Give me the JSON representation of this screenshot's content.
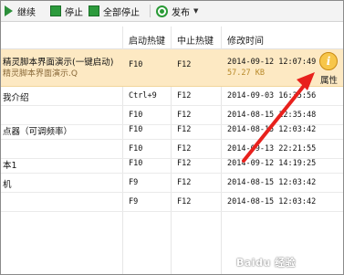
{
  "toolbar": {
    "continue_label": "继续",
    "stop_label": "停止",
    "stop_all_label": "全部停止",
    "publish_label": "发布"
  },
  "columns": {
    "start_hotkey": "启动热键",
    "stop_hotkey": "中止热键",
    "modified_time": "修改时间"
  },
  "rows": [
    {
      "name": "精灵脚本界面演示(一键启动)",
      "name_sub": "精灵脚本界面演示.Q",
      "start": "F10",
      "stop": "F12",
      "time": "2014-09-12 12:07:49",
      "size": "57.27 KB",
      "selected": true
    },
    {
      "name": "我介绍",
      "start": "Ctrl+9",
      "stop": "F12",
      "time": "2014-09-03 16:35:56"
    },
    {
      "name": "",
      "start": "F10",
      "stop": "F12",
      "time": "2014-08-15 12:35:48"
    },
    {
      "name": "点器（可调频率）",
      "start": "F10",
      "stop": "F12",
      "time": "2014-08-15 12:03:42"
    },
    {
      "name": "",
      "start": "F10",
      "stop": "F12",
      "time": "2014-09-13 22:21:55"
    },
    {
      "name": "本1",
      "start": "F10",
      "stop": "F12",
      "time": "2014-09-12 14:19:25"
    },
    {
      "name": "机",
      "start": "F9",
      "stop": "F12",
      "time": "2014-08-15 12:03:42"
    },
    {
      "name": "",
      "start": "F9",
      "stop": "F12",
      "time": "2014-08-15 12:03:42"
    }
  ],
  "properties": {
    "label": "属性",
    "icon": "info-icon"
  },
  "watermark": "Baidu 经验",
  "colors": {
    "selected_row": "#fde9c3",
    "arrow": "#e8211d",
    "toolbar_green": "#2c9a3c"
  }
}
